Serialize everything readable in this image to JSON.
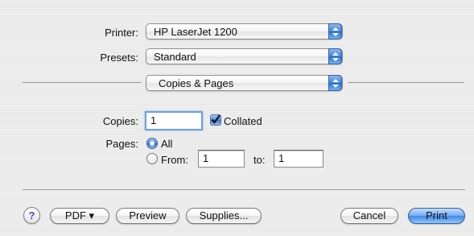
{
  "printer": {
    "label": "Printer:",
    "value": "HP LaserJet 1200"
  },
  "presets": {
    "label": "Presets:",
    "value": "Standard"
  },
  "panel": {
    "value": "Copies & Pages"
  },
  "copies": {
    "label": "Copies:",
    "value": "1",
    "collated_label": "Collated",
    "collated_checked": true
  },
  "pages": {
    "label": "Pages:",
    "all_label": "All",
    "from_label": "From:",
    "from_value": "1",
    "to_label": "to:",
    "to_value": "1",
    "selected": "all"
  },
  "buttons": {
    "help": "?",
    "pdf": "PDF ▾",
    "preview": "Preview",
    "supplies": "Supplies...",
    "cancel": "Cancel",
    "print": "Print"
  },
  "colors": {
    "accent": "#3f88e5",
    "background": "#ececec"
  }
}
